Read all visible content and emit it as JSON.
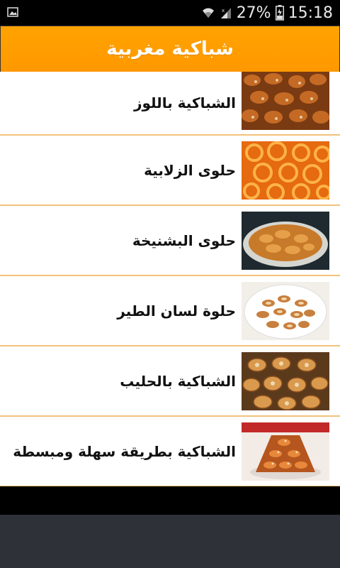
{
  "status_bar": {
    "battery_percent": "27%",
    "time": "15:18",
    "icons": [
      "image-notification-icon",
      "wifi-icon",
      "signal-icon",
      "battery-icon"
    ]
  },
  "app_bar": {
    "title": "شباكية مغربية",
    "color": "#ff9800"
  },
  "list": {
    "items": [
      {
        "label": "الشباكية باللوز",
        "thumb": "chebakia-almonds-image"
      },
      {
        "label": "حلوى الزلابية",
        "thumb": "zlabia-image"
      },
      {
        "label": "حلوى البشنيخة",
        "thumb": "bachnikha-image"
      },
      {
        "label": "حلوة لسان الطير",
        "thumb": "lsan-tir-image"
      },
      {
        "label": "الشباكية بالحليب",
        "thumb": "chebakia-milk-image"
      },
      {
        "label": "الشباكية بطريقة سهلة ومبسطة",
        "thumb": "chebakia-easy-image"
      }
    ],
    "divider_color": "#f2c27a"
  }
}
